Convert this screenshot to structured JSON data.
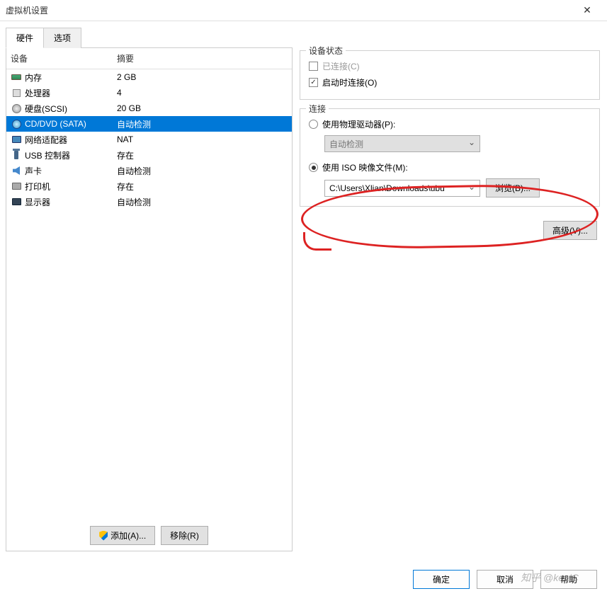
{
  "window": {
    "title": "虚拟机设置"
  },
  "tabs": {
    "hardware": "硬件",
    "options": "选项"
  },
  "table": {
    "header_device": "设备",
    "header_summary": "摘要",
    "rows": [
      {
        "icon": "mem",
        "name": "内存",
        "summary": "2 GB"
      },
      {
        "icon": "cpu",
        "name": "处理器",
        "summary": "4"
      },
      {
        "icon": "disk",
        "name": "硬盘(SCSI)",
        "summary": "20 GB"
      },
      {
        "icon": "cd",
        "name": "CD/DVD (SATA)",
        "summary": "自动检测",
        "selected": true
      },
      {
        "icon": "net",
        "name": "网络适配器",
        "summary": "NAT"
      },
      {
        "icon": "usb",
        "name": "USB 控制器",
        "summary": "存在"
      },
      {
        "icon": "snd",
        "name": "声卡",
        "summary": "自动检测"
      },
      {
        "icon": "prn",
        "name": "打印机",
        "summary": "存在"
      },
      {
        "icon": "disp",
        "name": "显示器",
        "summary": "自动检测"
      }
    ]
  },
  "left_buttons": {
    "add": "添加(A)...",
    "remove": "移除(R)"
  },
  "device_status": {
    "group_label": "设备状态",
    "connected": "已连接(C)",
    "connect_at_poweron": "启动时连接(O)"
  },
  "connection": {
    "group_label": "连接",
    "use_physical": "使用物理驱动器(P):",
    "physical_value": "自动检测",
    "use_iso": "使用 ISO 映像文件(M):",
    "iso_path": "C:\\Users\\Xlian\\Downloads\\ubu",
    "browse": "浏览(B)..."
  },
  "advanced": "高级(V)...",
  "footer": {
    "ok": "确定",
    "cancel": "取消",
    "help": "帮助"
  },
  "watermark": "知乎 @keaiC"
}
